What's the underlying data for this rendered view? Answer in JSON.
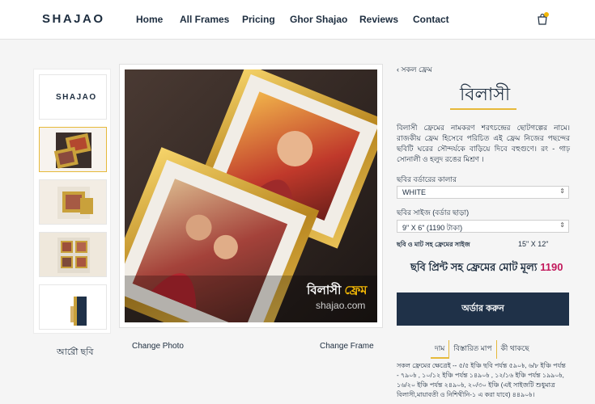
{
  "header": {
    "logo": "SHAJAO",
    "nav": [
      "Home",
      "All Frames",
      "Pricing",
      "Ghor Shajao",
      "Reviews",
      "Contact"
    ]
  },
  "thumbs": {
    "logo": "SHAJAO",
    "more_label": "আরো ছবি"
  },
  "main_image": {
    "caption_main": "বিলাসী",
    "caption_accent": "ফ্রেম",
    "caption_site": "shajao.com"
  },
  "links": {
    "change_photo": "Change Photo",
    "change_frame": "Change Frame"
  },
  "product": {
    "back_link": "সকল ফ্রেম",
    "title": "বিলাসী",
    "description": "বিলাসী ফ্রেমের নামকরণ শরৎচন্দ্রের ছোটগল্পের নামে। রাজকীয় ফ্রেম হিসেবে পরিচিত এই ফ্রেম নিজের পছন্দের ছবিটি ঘরের সৌন্দর্যকে বাড়িয়ে দিবে বহুগুণে। রং - গাঢ় সোনালী ও হলুদ রঙের মিশ্রণ ।",
    "border_label": "ছবির বর্ডারের কালার",
    "border_value": "WHITE",
    "size_label": "ছবির সাইজ (বর্ডার ছাড়া)",
    "size_value": "9\" X 6\" (1190 টাকা)",
    "frame_size_label": "ছবি ও মাট সহ ফ্রেমের সাইজ",
    "frame_size_value": "15\" X 12\"",
    "total_label": "ছবি প্রিন্ট সহ ফ্রেমের মোট মূল্য",
    "total_price": "1190",
    "order_button": "অর্ডার করুন",
    "tabs": [
      "দাম",
      "বিস্তারিত মাপ",
      "কী থাকছে"
    ],
    "tab_body": "সকল ফ্রেমের ক্ষেত্রেই -- ৫/৫ ইঞ্চি ছবি পর্যন্ত ৫৯০৳, ৬/৮ ইঞ্চি পর্যন্ত - ৭৯০৳ , ১০/১২ ইঞ্চি পর্যন্ত ১৪৯০৳ , ১২/১৬ ইঞ্চি পর্যন্ত ১৯৯০৳, ১৬/২০ ইঞ্চি পর্যন্ত ২৪৯০৳, ২০/৩০ ইঞ্চি (এই সাইজটি শুধুমাত্র বিলাসী,মায়াবতী ও নিশিথীনি-১ এ করা যাবে) ৪৪৯০৳।"
  },
  "colors": {
    "navy": "#1f3148",
    "gold": "#e6b93a",
    "price": "#c2185b"
  }
}
